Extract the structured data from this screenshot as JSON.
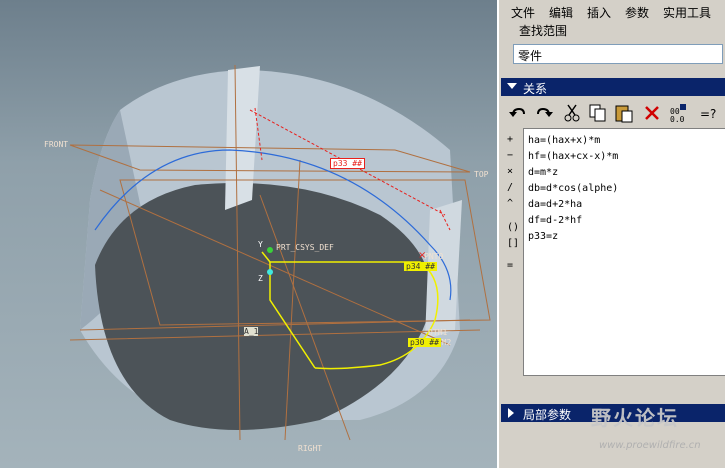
{
  "menu": [
    "文件",
    "编辑",
    "插入",
    "参数",
    "实用工具"
  ],
  "search": {
    "label": "查找范围",
    "value": "零件"
  },
  "relations": {
    "header": "关系",
    "operators": [
      "+",
      "−",
      "×",
      "/",
      "^",
      "()",
      "[]",
      "="
    ],
    "lines": [
      "ha=(hax+x)*m",
      "hf=(hax+cx-x)*m",
      "d=m*z",
      "db=d*cos(alphe)",
      "da=d+2*ha",
      "df=d-2*hf",
      "p33=z"
    ]
  },
  "local_params": {
    "header": "局部参数"
  },
  "watermark": {
    "text": "野火论坛",
    "url": "www.proewildfire.cn"
  },
  "viewport": {
    "datum_labels": [
      "FRONT",
      "TOP",
      "RIGHT",
      "PRT_CSYS_DEF",
      "PNT0",
      "DTM1",
      "DTM2",
      "A_1"
    ],
    "dim_tags": [
      "p33 ##",
      "p34 ##",
      "p30 ##"
    ],
    "axis_labels": [
      "Y",
      "Z"
    ]
  },
  "colors": {
    "header_bg": "#0a246a",
    "panel_bg": "#d4d0c8",
    "dim_red": "#e8201c",
    "sketch_yellow": "#f0f000",
    "datum_brown": "#b07040"
  }
}
